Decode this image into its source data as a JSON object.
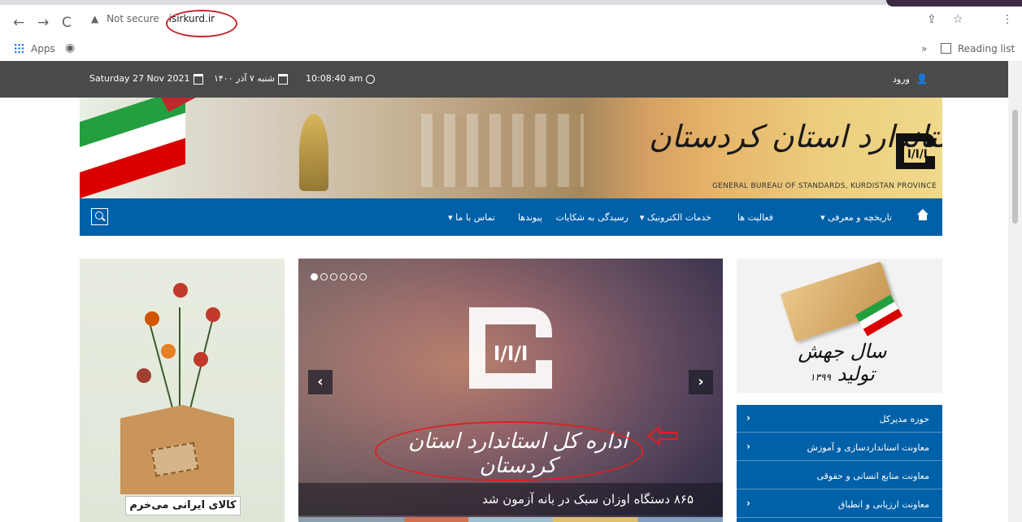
{
  "browser": {
    "security_label": "Not secure",
    "url": "isirkurd.ir",
    "bookmarks": {
      "apps_label": "Apps",
      "overflow_label": "»",
      "reading_list_label": "Reading list"
    }
  },
  "topbar": {
    "date_en": "Saturday 27 Nov 2021",
    "date_fa": "شنبه ۷ آذر ۱۴۰۰",
    "time": "10:08:40 am",
    "login_label": "ورود"
  },
  "banner": {
    "title_fa": "اداره کل استاندارد استان کردستان",
    "subtitle_en": "GENERAL BUREAU OF STANDARDS, KURDISTAN PROVINCE",
    "logo_text": "ا/ا/ا"
  },
  "nav": {
    "items": [
      {
        "label": "تاریخچه و معرفی ▾"
      },
      {
        "label": "فعالیت ها"
      },
      {
        "label": "خدمات الکترونیک ▾"
      },
      {
        "label": "رسیدگی به شکایات"
      },
      {
        "label": "پیوندها"
      },
      {
        "label": "تماس با ما ▾"
      }
    ]
  },
  "left_poster": {
    "caption": "کالای ایرانی می‌خرم"
  },
  "slider": {
    "dots": 6,
    "active_dot": 0,
    "slide_title": "اداره کل استاندارد استان کردستان",
    "caption": "۸۶۵ دستگاه اوزان سبک در بانه آزمون شد",
    "prev_label": "‹",
    "next_label": "›"
  },
  "right_poster": {
    "text": "سال جهش تولید",
    "year": "۱۳۹۹"
  },
  "side_menu": {
    "items": [
      {
        "label": "حوزه مدیرکل",
        "has_chevron": true
      },
      {
        "label": "معاونت استانداردسازی و آموزش",
        "has_chevron": true
      },
      {
        "label": "معاونت منابع انسانی و حقوقی",
        "has_chevron": false
      },
      {
        "label": "معاونت ارزیابی و انطباق",
        "has_chevron": true
      }
    ]
  },
  "colors": {
    "nav_blue": "#0060a8",
    "topbar_gray": "#4a4a4a",
    "annotation_red": "#c0272d"
  }
}
